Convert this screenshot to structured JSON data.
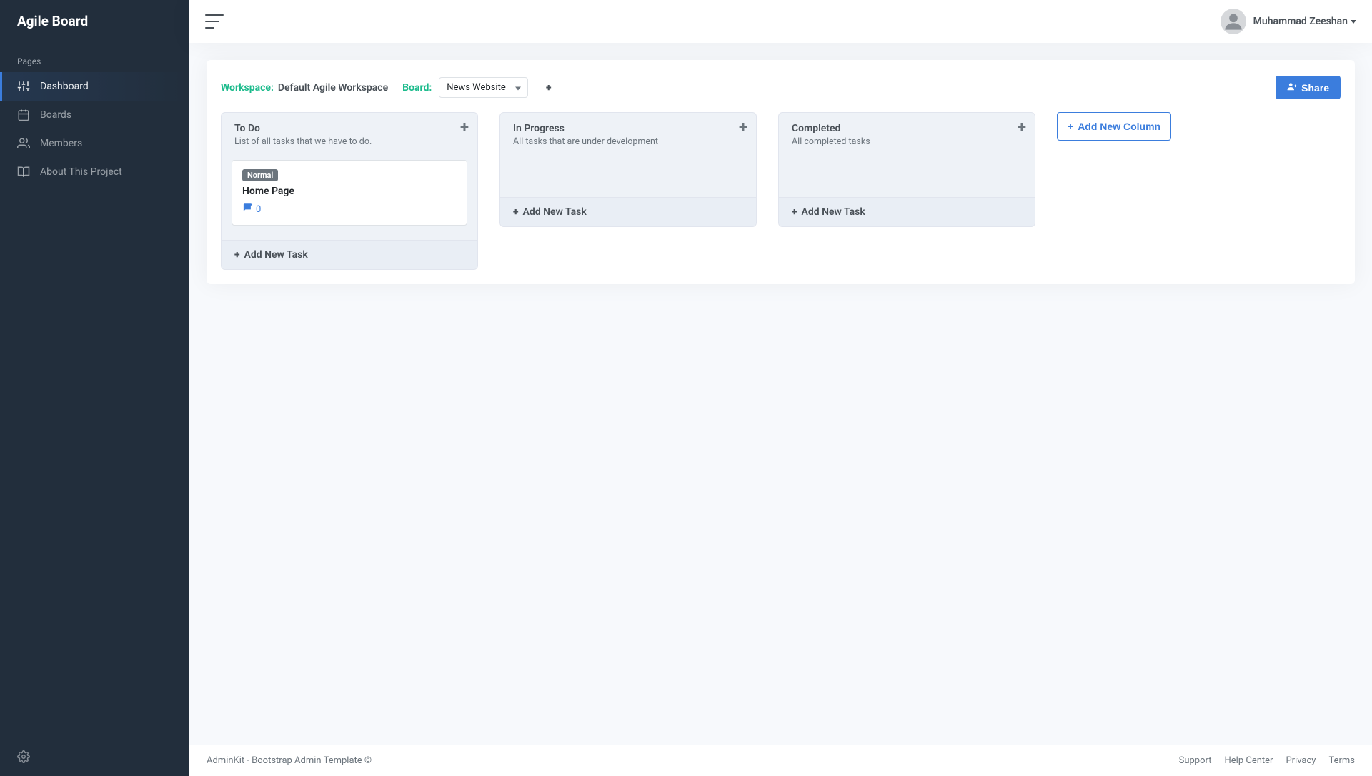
{
  "brand": "Agile Board",
  "sidebar": {
    "section_label": "Pages",
    "items": [
      {
        "label": "Dashboard",
        "icon": "sliders-icon",
        "active": true
      },
      {
        "label": "Boards",
        "icon": "calendar-icon",
        "active": false
      },
      {
        "label": "Members",
        "icon": "users-icon",
        "active": false
      },
      {
        "label": "About This Project",
        "icon": "book-icon",
        "active": false
      }
    ]
  },
  "user": {
    "name": "Muhammad Zeeshan"
  },
  "breadcrumb": {
    "workspace_label": "Workspace:",
    "workspace_name": "Default Agile Workspace",
    "board_label": "Board:",
    "board_selected": "News Website"
  },
  "share_button": "Share",
  "add_task_label": "Add New Task",
  "add_column_label": "Add New Column",
  "columns": [
    {
      "title": "To Do",
      "subtitle": "List of all tasks that we have to do.",
      "tasks": [
        {
          "badge": "Normal",
          "title": "Home Page",
          "comments": "0"
        }
      ]
    },
    {
      "title": "In Progress",
      "subtitle": "All tasks that are under development",
      "tasks": []
    },
    {
      "title": "Completed",
      "subtitle": "All completed tasks",
      "tasks": []
    }
  ],
  "footer": {
    "left_name": "AdminKit",
    "left_rest": " - Bootstrap Admin Template ©",
    "links": [
      "Support",
      "Help Center",
      "Privacy",
      "Terms"
    ]
  }
}
